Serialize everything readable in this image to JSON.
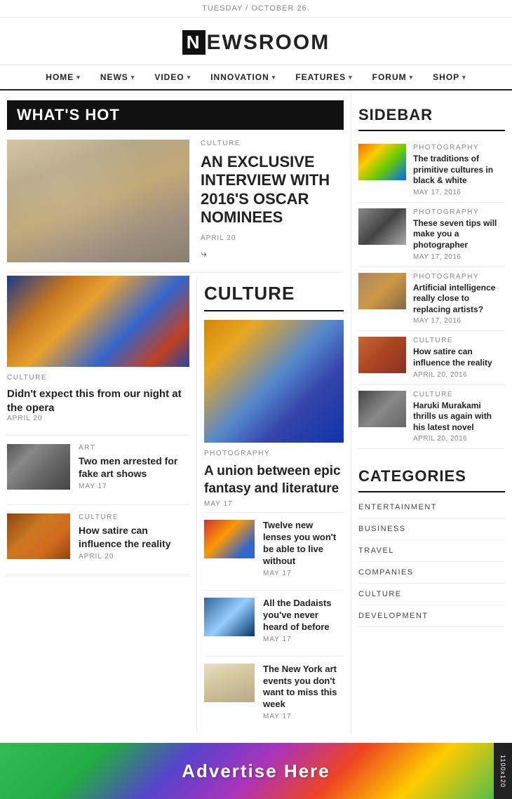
{
  "topbar": {
    "date": "TUESDAY / OCTOBER 26."
  },
  "header": {
    "logo_n": "N",
    "logo_text": "EWSROOM"
  },
  "nav": {
    "items": [
      {
        "label": "HOME",
        "has_chevron": true
      },
      {
        "label": "NEWS",
        "has_chevron": true
      },
      {
        "label": "VIDEO",
        "has_chevron": true
      },
      {
        "label": "INNOVATION",
        "has_chevron": true
      },
      {
        "label": "FEATURES",
        "has_chevron": true
      },
      {
        "label": "FORUM",
        "has_chevron": true
      },
      {
        "label": "SHOP",
        "has_chevron": true
      }
    ]
  },
  "whats_hot": {
    "section_label": "WHAT'S HOT",
    "feature": {
      "category": "CULTURE",
      "title": "AN EXCLUSIVE INTERVIEW WITH 2016'S OSCAR NOMINEES",
      "date": "APRIL 20"
    }
  },
  "left_articles": [
    {
      "category": "CULTURE",
      "title": "Didn't expect this from our night at the opera",
      "date": "APRIL 20"
    },
    {
      "category": "ART",
      "title": "Two men arrested for fake art shows",
      "date": "MAY 17"
    },
    {
      "category": "CULTURE",
      "title": "How satire can influence the reality",
      "date": "APRIL 20"
    }
  ],
  "culture_section": {
    "section_label": "CULTURE",
    "main_article": {
      "category": "PHOTOGRAPHY",
      "title": "A union between epic fantasy and literature",
      "date": "MAY 17"
    },
    "small_articles": [
      {
        "title": "Twelve new lenses you won't be able to live without",
        "date": "MAY 17"
      },
      {
        "title": "All the Dadaists you've never heard of before",
        "date": "MAY 17"
      },
      {
        "title": "The New York art events you don't want to miss this week",
        "date": "MAY 17"
      }
    ]
  },
  "sidebar": {
    "title": "SIDEBAR",
    "items": [
      {
        "category": "PHOTOGRAPHY",
        "title": "The traditions of primitive cultures in black & white",
        "date": "MAY 17, 2016"
      },
      {
        "category": "PHOTOGRAPHY",
        "title": "These seven tips will make you a photographer",
        "date": "MAY 17, 2016"
      },
      {
        "category": "PHOTOGRAPHY",
        "title": "Artificial intelligence really close to replacing artists?",
        "date": "MAY 17, 2016"
      },
      {
        "category": "CULTURE",
        "title": "How satire can influence the reality",
        "date": "APRIL 20, 2016"
      },
      {
        "category": "CULTURE",
        "title": "Haruki Murakami thrills us again with his latest novel",
        "date": "APRIL 20, 2016"
      }
    ]
  },
  "categories": {
    "title": "CATEGORIES",
    "items": [
      "ENTERTAINMENT",
      "BUSINESS",
      "TRAVEL",
      "COMPANIES",
      "CULTURE",
      "DEVELOPMENT"
    ]
  },
  "ad": {
    "text": "Advertise Here",
    "size_label": "1100x120"
  }
}
